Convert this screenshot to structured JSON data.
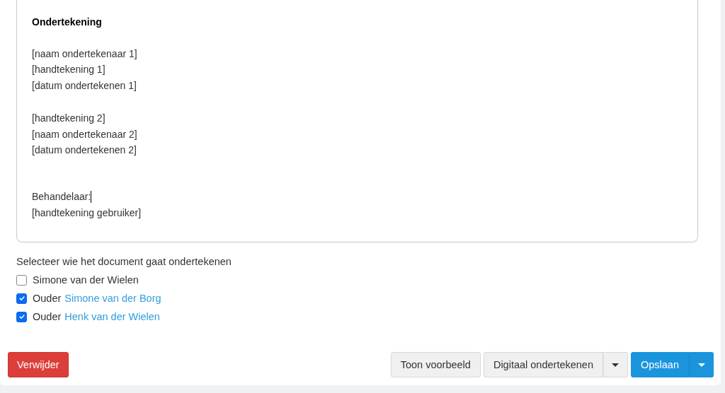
{
  "editor": {
    "blocks": [
      {
        "kind": "heading",
        "lines": [
          {
            "text": "Ondertekening",
            "caret": false
          }
        ]
      },
      {
        "kind": "paragraph",
        "lines": [
          {
            "text": "[naam ondertekenaar 1]",
            "caret": false
          },
          {
            "text": "[handtekening 1]",
            "caret": false
          },
          {
            "text": "[datum ondertekenen 1]",
            "caret": false
          }
        ]
      },
      {
        "kind": "paragraph",
        "lines": [
          {
            "text": "[handtekening 2]",
            "caret": false
          },
          {
            "text": "[naam ondertekenaar 2]",
            "caret": false
          },
          {
            "text": "[datum ondertekenen 2]",
            "caret": false
          }
        ]
      },
      {
        "kind": "paragraph",
        "lines": [
          {
            "text": "Behandelaar:",
            "caret": true
          },
          {
            "text": "[handtekening gebruiker]",
            "caret": false
          }
        ]
      }
    ]
  },
  "signers": {
    "label": "Selecteer wie het document gaat ondertekenen",
    "items": [
      {
        "name": "Simone van der Wielen",
        "link": false,
        "checked": false
      },
      {
        "prefix": "Ouder",
        "name": "Simone van der Borg",
        "link": true,
        "checked": true
      },
      {
        "prefix": "Ouder",
        "name": "Henk van der Wielen",
        "link": true,
        "checked": true
      }
    ]
  },
  "buttons": {
    "delete": "Verwijder",
    "preview": "Toon voorbeeld",
    "sign": "Digitaal ondertekenen",
    "save": "Opslaan"
  }
}
